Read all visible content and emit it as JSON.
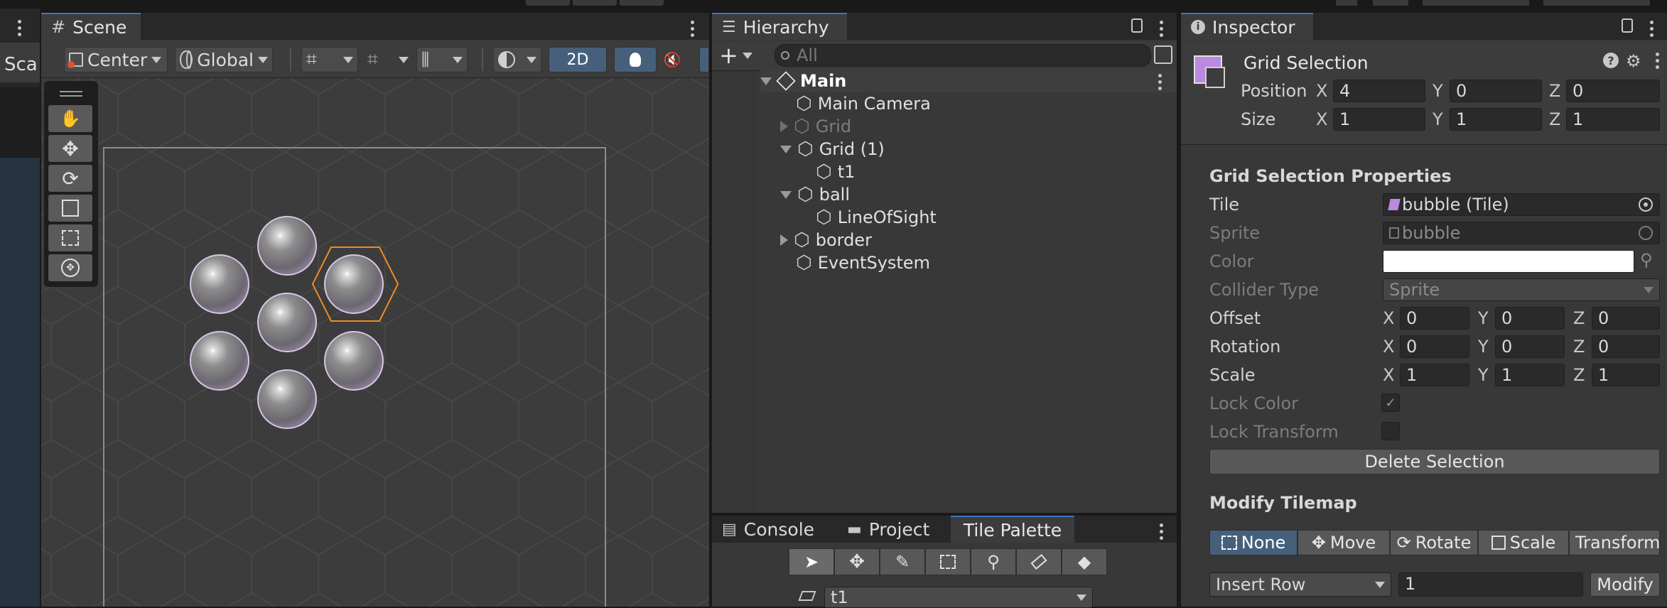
{
  "scene": {
    "tab_label": "Scene",
    "side_label": "Sca",
    "toolbar": {
      "pivot_label": "Center",
      "space_label": "Global",
      "mode_2d": "2D"
    },
    "tools": [
      "hand-tool",
      "move-tool",
      "rotate-tool",
      "scale-tool",
      "rect-tool",
      "transform-tool"
    ]
  },
  "hierarchy": {
    "tab_label": "Hierarchy",
    "search_placeholder": "All",
    "items": [
      {
        "label": "Main",
        "kind": "scene",
        "expanded": true
      },
      {
        "label": "Main Camera",
        "kind": "object"
      },
      {
        "label": "Grid",
        "kind": "object",
        "disabled": true,
        "expanded": false
      },
      {
        "label": "Grid (1)",
        "kind": "object",
        "expanded": true
      },
      {
        "label": "t1",
        "kind": "object"
      },
      {
        "label": "ball",
        "kind": "object",
        "expanded": true
      },
      {
        "label": "LineOfSight",
        "kind": "object"
      },
      {
        "label": "border",
        "kind": "object",
        "expanded": false
      },
      {
        "label": "EventSystem",
        "kind": "object"
      }
    ]
  },
  "bottom_tabs": {
    "console": "Console",
    "project": "Project",
    "tile_palette": "Tile Palette",
    "active_palette": "t1"
  },
  "inspector": {
    "tab_label": "Inspector",
    "header_title": "Grid Selection",
    "position_label": "Position",
    "size_label": "Size",
    "position": {
      "x": "4",
      "y": "0",
      "z": "0"
    },
    "size": {
      "x": "1",
      "y": "1",
      "z": "1"
    },
    "axis": {
      "x": "X",
      "y": "Y",
      "z": "Z"
    },
    "section_title": "Grid Selection Properties",
    "tile_label": "Tile",
    "tile_value": "bubble (Tile)",
    "sprite_label": "Sprite",
    "sprite_value": "bubble",
    "color_label": "Color",
    "color_value": "#ffffff",
    "collider_label": "Collider Type",
    "collider_value": "Sprite",
    "offset_label": "Offset",
    "offset": {
      "x": "0",
      "y": "0",
      "z": "0"
    },
    "rotation_label": "Rotation",
    "rotation": {
      "x": "0",
      "y": "0",
      "z": "0"
    },
    "scale_label": "Scale",
    "scale": {
      "x": "1",
      "y": "1",
      "z": "1"
    },
    "lock_color_label": "Lock Color",
    "lock_color_checked": true,
    "lock_transform_label": "Lock Transform",
    "lock_transform_checked": false,
    "delete_button": "Delete Selection",
    "modify_title": "Modify Tilemap",
    "modes": [
      "None",
      "Move",
      "Rotate",
      "Scale",
      "Transform"
    ],
    "active_mode": "None",
    "insert_option": "Insert Row",
    "insert_count": "1",
    "modify_button": "Modify"
  },
  "colors": {
    "accent_blue": "#3a79bb",
    "active_toggle": "#46607c",
    "selection_orange": "#f08a24",
    "panel_bg": "#383838"
  }
}
